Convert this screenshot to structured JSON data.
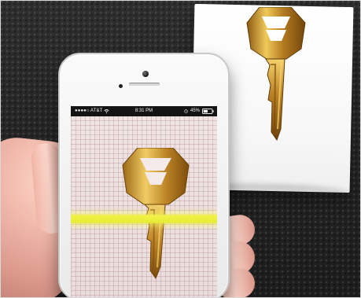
{
  "status_bar": {
    "carrier": "●●●●○ AT&T",
    "time": "8:31 PM",
    "battery": "45%"
  },
  "icons": {
    "wifi": "wifi-icon",
    "clock": "clock-icon",
    "battery": "battery-icon",
    "key": "key-icon"
  },
  "scan": {
    "line_color": "#F0F03F"
  },
  "colors": {
    "background": "#262626",
    "paper": "#FFFFFF",
    "phone": "#F3F3F3",
    "grid_line": "#9A5959",
    "key_gold": "#C9972C"
  }
}
